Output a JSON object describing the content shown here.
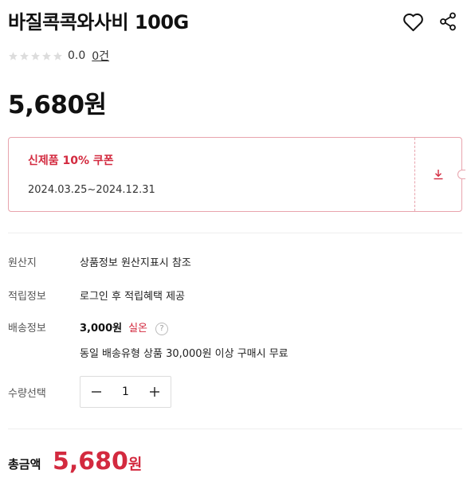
{
  "product": {
    "title": "바질콕콕와사비 100G",
    "rating_score": "0.0",
    "review_count": "0건",
    "price": "5,680원"
  },
  "icons": {
    "wishlist": "heart-icon",
    "share": "share-icon",
    "download": "download-icon",
    "help": "question-icon"
  },
  "coupon": {
    "name": "신제품 10% 쿠폰",
    "period": "2024.03.25~2024.12.31"
  },
  "info": {
    "origin_label": "원산지",
    "origin_value": "상품정보 원산지표시 참조",
    "points_label": "적립정보",
    "points_value": "로그인 후 적립혜택 제공",
    "shipping_label": "배송정보",
    "shipping_price": "3,000원",
    "shipping_tag": "실온",
    "shipping_help": "?",
    "shipping_note": "동일 배송유형 상품 30,000원 이상 구매시 무료",
    "quantity_label": "수량선택",
    "quantity_value": "1"
  },
  "total": {
    "label": "총금액",
    "amount": "5,680",
    "unit": "원"
  },
  "colors": {
    "accent": "#d32a3f",
    "coupon_border": "#e8a4ad",
    "star_empty": "#dddddd"
  }
}
